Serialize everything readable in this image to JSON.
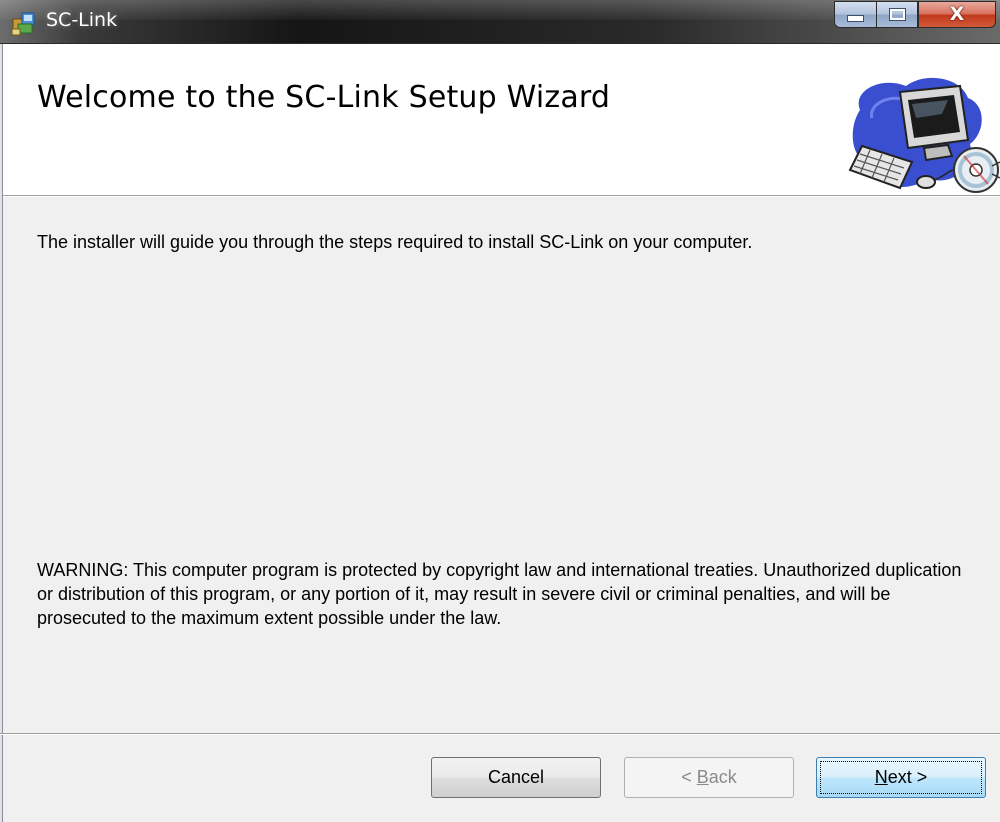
{
  "window": {
    "title": "SC-Link",
    "icon": "installer-package-icon",
    "controls": [
      "minimize-icon",
      "maximize-icon",
      "close-icon"
    ],
    "close_glyph": "X"
  },
  "banner": {
    "title": "Welcome to the SC-Link Setup Wizard",
    "graphic": "computer-setup-clipart-icon"
  },
  "body": {
    "intro": "The installer will guide you through the steps required to install SC-Link on your computer.",
    "warning": "WARNING: This computer program is protected by copyright law and international treaties. Unauthorized duplication or distribution of this program, or any portion of it, may result in severe civil or criminal penalties, and will be prosecuted to the maximum extent possible under the law."
  },
  "buttons": {
    "cancel": "Cancel",
    "back": "< Back",
    "back_prefix": "< ",
    "back_accel": "B",
    "back_rest": "ack",
    "next": "Next >",
    "next_accel": "N",
    "next_rest": "ext >",
    "back_enabled": false,
    "default_button": "next"
  },
  "colors": {
    "close_red": "#c0391b",
    "default_button_border": "#3c7fb1",
    "disabled_text": "#8a8a8a"
  }
}
